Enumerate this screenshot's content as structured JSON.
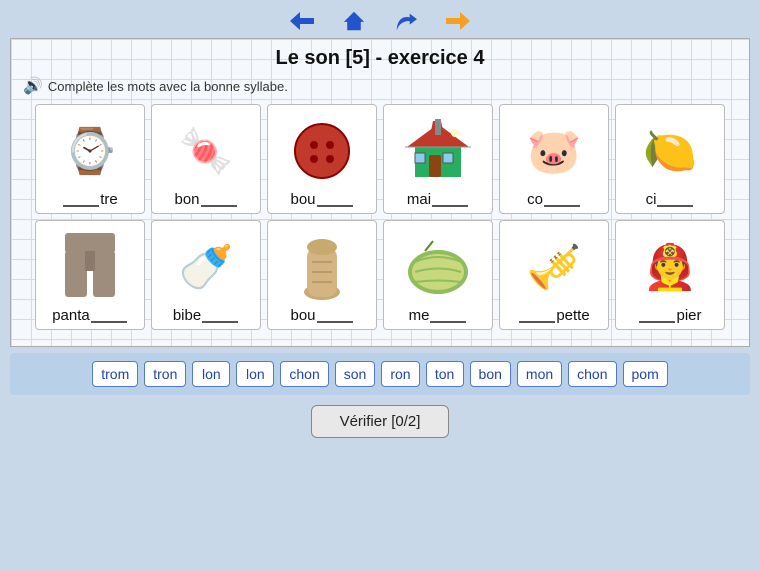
{
  "nav": {
    "back_label": "←",
    "home_label": "🏠",
    "forward_label": "→",
    "redo_label": "↻"
  },
  "title": "Le son [5] - exercice 4",
  "instruction": "Complète les mots avec la bonne syllabe.",
  "rows": [
    [
      {
        "id": "montre",
        "emoji": "⌚",
        "prefix": "",
        "suffix": "tre",
        "blank_before": true
      },
      {
        "id": "bonbon",
        "emoji": "🍬",
        "prefix": "bon",
        "suffix": "",
        "blank_before": false
      },
      {
        "id": "bouton",
        "emoji": "🔴",
        "prefix": "bou",
        "suffix": "",
        "blank_before": false
      },
      {
        "id": "maison",
        "emoji": "🏠",
        "prefix": "mai",
        "suffix": "",
        "blank_before": false
      },
      {
        "id": "cochon",
        "emoji": "🐷",
        "prefix": "co",
        "suffix": "",
        "blank_before": false
      },
      {
        "id": "citron",
        "emoji": "🍋",
        "prefix": "ci",
        "suffix": "",
        "blank_before": false
      }
    ],
    [
      {
        "id": "pantalon",
        "emoji": "👖",
        "prefix": "panta",
        "suffix": "",
        "blank_before": false
      },
      {
        "id": "biberon",
        "emoji": "🍼",
        "prefix": "bibe",
        "suffix": "",
        "blank_before": false
      },
      {
        "id": "bouchon",
        "emoji": "🪨",
        "prefix": "bou",
        "suffix": "",
        "blank_before": false
      },
      {
        "id": "melon",
        "emoji": "🍈",
        "prefix": "me",
        "suffix": "",
        "blank_before": false
      },
      {
        "id": "trompette",
        "emoji": "🎺",
        "prefix": "",
        "suffix": "pette",
        "blank_before": true
      },
      {
        "id": "pompier",
        "emoji": "👨‍🚒",
        "prefix": "",
        "suffix": "pier",
        "blank_before": true
      }
    ]
  ],
  "syllables": [
    "trom",
    "tron",
    "lon",
    "lon",
    "chon",
    "son",
    "ron",
    "ton",
    "bon",
    "mon",
    "chon",
    "pom"
  ],
  "verify_btn": "Vérifier [0/2]"
}
